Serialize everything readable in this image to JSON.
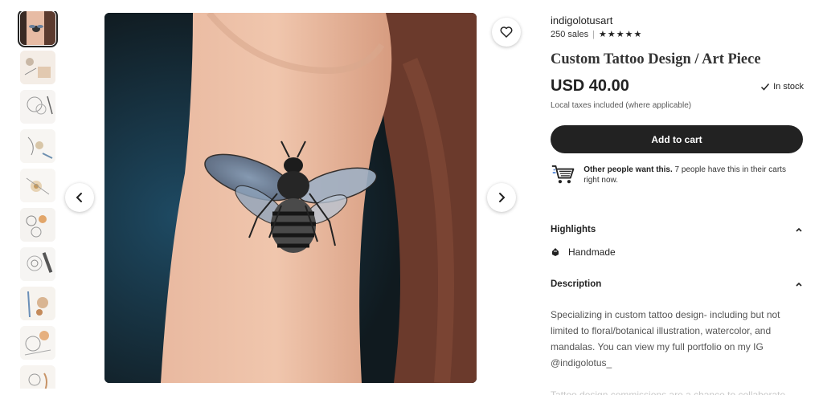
{
  "gallery": {
    "thumbnails": [
      {
        "name": "thumb-bee-tattoo",
        "active": true
      },
      {
        "name": "thumb-sketch-1"
      },
      {
        "name": "thumb-sketch-2"
      },
      {
        "name": "thumb-sketch-3"
      },
      {
        "name": "thumb-sketch-4"
      },
      {
        "name": "thumb-sketch-5"
      },
      {
        "name": "thumb-sketch-6"
      },
      {
        "name": "thumb-sketch-7"
      },
      {
        "name": "thumb-sketch-8"
      },
      {
        "name": "thumb-sketch-9"
      }
    ],
    "prev_icon": "chevron-left-icon",
    "next_icon": "chevron-right-icon",
    "favorite_icon": "heart-icon"
  },
  "shop": {
    "name": "indigolotusart",
    "sales": "250 sales",
    "separator": "|",
    "rating_stars": 5
  },
  "listing": {
    "title": "Custom Tattoo Design / Art Piece",
    "price": "USD 40.00",
    "stock": "In stock",
    "taxes": "Local taxes included (where applicable)",
    "add_to_cart": "Add to cart"
  },
  "demand": {
    "bold": "Other people want this.",
    "text": " 7 people have this in their carts right now."
  },
  "highlights": {
    "heading": "Highlights",
    "items": [
      "Handmade"
    ]
  },
  "description": {
    "heading": "Description",
    "body": "Specializing in custom tattoo design- including but not limited to floral/botanical illustration, watercolor, and mandalas. You can view my full portfolio on my IG @indigolotus_",
    "faded": "Tattoo design commissions are a chance to collaborate"
  },
  "colors": {
    "primary": "#222222",
    "muted": "#595959"
  }
}
